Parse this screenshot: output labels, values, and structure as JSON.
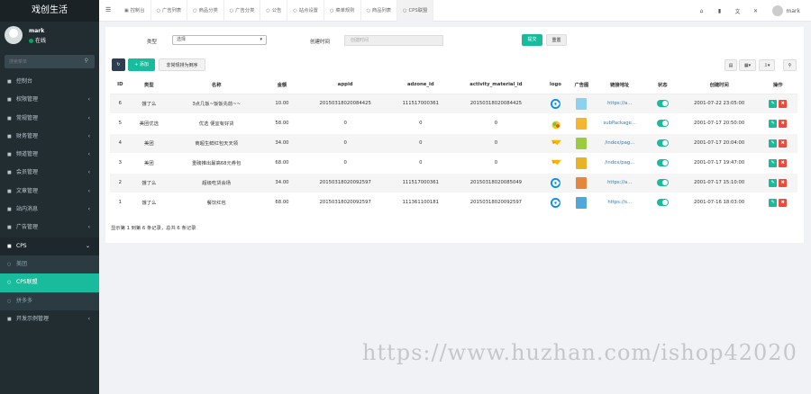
{
  "brand": "戏创生活",
  "user": {
    "name": "mark",
    "status": "在线"
  },
  "sidebar": {
    "search_placeholder": "搜索菜单",
    "items": [
      {
        "label": "控制台",
        "icon": "dashboard-icon",
        "chev": ""
      },
      {
        "label": "权限管理",
        "icon": "group-icon",
        "chev": "‹"
      },
      {
        "label": "常规管理",
        "icon": "cog-icon",
        "chev": "‹"
      },
      {
        "label": "财务管理",
        "icon": "money-icon",
        "chev": "‹"
      },
      {
        "label": "频道管理",
        "icon": "list-icon",
        "chev": "‹"
      },
      {
        "label": "会员管理",
        "icon": "user-icon",
        "chev": "‹"
      },
      {
        "label": "文章管理",
        "icon": "file-icon",
        "chev": "‹"
      },
      {
        "label": "站内消息",
        "icon": "message-icon",
        "chev": "‹"
      },
      {
        "label": "广告管理",
        "icon": "ad-icon",
        "chev": "‹"
      },
      {
        "label": "CPS",
        "icon": "cps-icon",
        "chev": "⌄"
      },
      {
        "label": "美团",
        "icon": "circle-icon",
        "chev": ""
      },
      {
        "label": "CPS联盟",
        "icon": "circle-icon",
        "chev": ""
      },
      {
        "label": "拼多多",
        "icon": "circle-icon",
        "chev": ""
      },
      {
        "label": "开发示例管理",
        "icon": "code-icon",
        "chev": "‹"
      }
    ]
  },
  "topnav": {
    "tabs": [
      "控制台",
      "广告列表",
      "商品分类",
      "广告分类",
      "公告",
      "站点设置",
      "菜单规则",
      "商品列表",
      "CPS联盟"
    ],
    "username": "mark"
  },
  "filter": {
    "type_label": "类型",
    "type_value": "选择",
    "time_label": "创建时间",
    "time_placeholder": "创建时间",
    "submit": "提交",
    "reset": "重置"
  },
  "toolbar": {
    "add": "+ 添加",
    "sort": "非常规排为倒序"
  },
  "table": {
    "headers": [
      "ID",
      "类型",
      "名称",
      "金额",
      "appid",
      "adzone_id",
      "activity_material_id",
      "logo",
      "广告图",
      "链接地址",
      "状态",
      "创建时间",
      "操作"
    ],
    "rows": [
      {
        "id": "6",
        "type": "饿了么",
        "name": "3点几饭~饭饭先前~~",
        "amount": "10.00",
        "appid": "20150318020084425",
        "adzone": "111517000361",
        "material": "20150318020084425",
        "logo": "eleme",
        "img": "#8fd0ee",
        "url": "https://a...",
        "time": "2001-07-22 23:05:00"
      },
      {
        "id": "5",
        "type": "美团优选",
        "name": "优选 便宜有好货",
        "amount": "58.00",
        "appid": "0",
        "adzone": "0",
        "material": "0",
        "logo": "youxuan",
        "img": "#f2b630",
        "url": "subPackage...",
        "time": "2001-07-17 20:50:00"
      },
      {
        "id": "4",
        "type": "美团",
        "name": "商超生鲜红包天天领",
        "amount": "34.00",
        "appid": "0",
        "adzone": "0",
        "material": "0",
        "logo": "meituan",
        "img": "#9ccc3e",
        "url": "/index/pag...",
        "time": "2001-07-17 20:04:00"
      },
      {
        "id": "3",
        "type": "美团",
        "name": "重磅推出最高68元券包",
        "amount": "68.00",
        "appid": "0",
        "adzone": "0",
        "material": "0",
        "logo": "meituan",
        "img": "#e8b325",
        "url": "/index/pag...",
        "time": "2001-07-17 19:47:00"
      },
      {
        "id": "2",
        "type": "饿了么",
        "name": "超级吃货会场",
        "amount": "34.00",
        "appid": "20150318020092597",
        "adzone": "111517000361",
        "material": "20150318020085049",
        "logo": "eleme",
        "img": "#e4873c",
        "url": "https://a...",
        "time": "2001-07-17 15:10:00"
      },
      {
        "id": "1",
        "type": "饿了么",
        "name": "餐饮红包",
        "amount": "68.00",
        "appid": "20150318020092597",
        "adzone": "111361100181",
        "material": "20150318020092597",
        "logo": "eleme",
        "img": "#4fa8d8",
        "url": "https://s...",
        "time": "2001-07-16 18:03:00"
      }
    ],
    "footer": "显示第 1 到第 6 条记录，总共 6 条记录"
  },
  "watermark": "https://www.huzhan.com/ishop42020"
}
